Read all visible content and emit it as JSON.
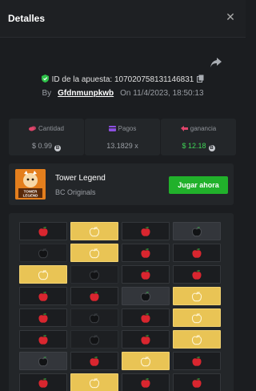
{
  "header": {
    "title": "Detalles",
    "close_icon": "close-icon"
  },
  "bet": {
    "id_label": "ID de la apuesta:",
    "id_value": "107020758131146831",
    "by_label": "By",
    "username": "Gfdnmunpkwb",
    "on_label": "On",
    "datetime": "11/4/2023, 18:50:13"
  },
  "stats": [
    {
      "label": "Cantidad",
      "value": "$ 0.99",
      "icon": "coins-icon",
      "icon_color": "#e0456b",
      "value_color": "#9a9ea4",
      "coin": true
    },
    {
      "label": "Pagos",
      "value": "13.1829 x",
      "icon": "payout-icon",
      "icon_color": "#8c4fe0",
      "value_color": "#9a9ea4",
      "coin": false
    },
    {
      "label": "ganancia",
      "value": "$ 12.18",
      "icon": "profit-icon",
      "icon_color": "#e0456b",
      "value_color": "#3fd356",
      "coin": true
    }
  ],
  "game": {
    "name": "Tower Legend",
    "provider": "BC Originals",
    "play_label": "Jugar ahora",
    "thumb_text": "TOWER LEGEND",
    "accent": "#21b12b"
  },
  "board": {
    "rows": [
      [
        "apple",
        "gold",
        "apple",
        "bad"
      ],
      [
        "dark",
        "gold",
        "apple",
        "apple"
      ],
      [
        "gold",
        "dark",
        "apple",
        "apple"
      ],
      [
        "apple",
        "apple",
        "bad",
        "gold"
      ],
      [
        "apple",
        "dark",
        "apple",
        "gold"
      ],
      [
        "apple",
        "dark",
        "apple",
        "gold"
      ],
      [
        "bad",
        "apple",
        "gold",
        "apple"
      ],
      [
        "apple",
        "gold",
        "apple",
        "apple"
      ]
    ]
  }
}
